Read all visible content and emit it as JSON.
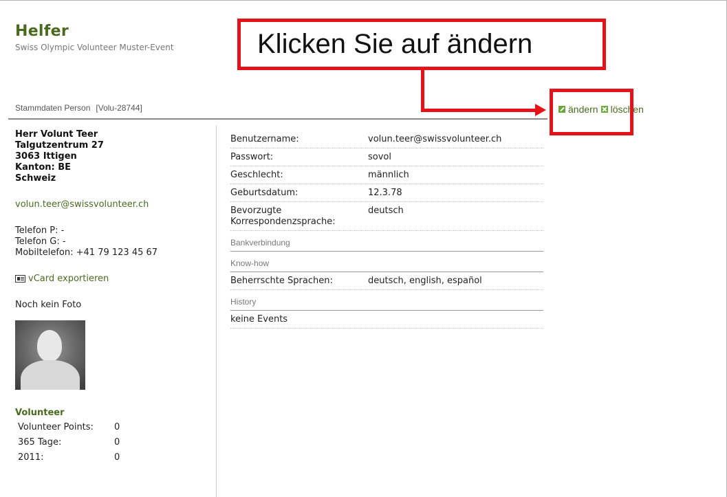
{
  "header": {
    "title": "Helfer",
    "subtitle": "Swiss Olympic Volunteer Muster-Event"
  },
  "callout": {
    "text": "Klicken Sie auf ändern",
    "color": "#e5121a"
  },
  "section": {
    "label": "Stammdaten Person",
    "id": "[Volu-28744]"
  },
  "actions": {
    "edit_label": "ändern",
    "delete_label": "löschen",
    "edit_icon": "pencil-icon",
    "delete_icon": "delete-icon"
  },
  "person": {
    "name": "Herr Volunt Teer",
    "street": "Talgutzentrum 27",
    "city": "3063 Ittigen",
    "canton": "Kanton: BE",
    "country": "Schweiz",
    "email": "volun.teer@swissvolunteer.ch",
    "phone_p": "Telefon P: -",
    "phone_g": "Telefon G: -",
    "mobile": "Mobiltelefon: +41 79 123 45 67",
    "vcard_label": "vCard exportieren",
    "no_photo": "Noch kein Foto"
  },
  "volunteer": {
    "title": "Volunteer",
    "rows": [
      {
        "label": "Volunteer Points:",
        "value": "0"
      },
      {
        "label": "365 Tage:",
        "value": "0"
      },
      {
        "label": "2011:",
        "value": "0"
      }
    ]
  },
  "details": {
    "rows": [
      {
        "label": "Benutzername:",
        "value": "volun.teer@swissvolunteer.ch"
      },
      {
        "label": "Passwort:",
        "value": "sovol"
      },
      {
        "label": "Geschlecht:",
        "value": "männlich"
      },
      {
        "label": "Geburtsdatum:",
        "value": "12.3.78"
      },
      {
        "label": "Bevorzugte Korrespondenzsprache:",
        "value": "deutsch"
      }
    ],
    "bank_heading": "Bankverbindung",
    "knowhow_heading": "Know-how",
    "languages_label": "Beherrschte Sprachen:",
    "languages_value": "deutsch, english, español",
    "history_heading": "History",
    "history_value": "keine Events"
  },
  "colors": {
    "accent_green": "#4a6b1f",
    "icon_green": "#6aa63a",
    "highlight_red": "#e5121a"
  }
}
